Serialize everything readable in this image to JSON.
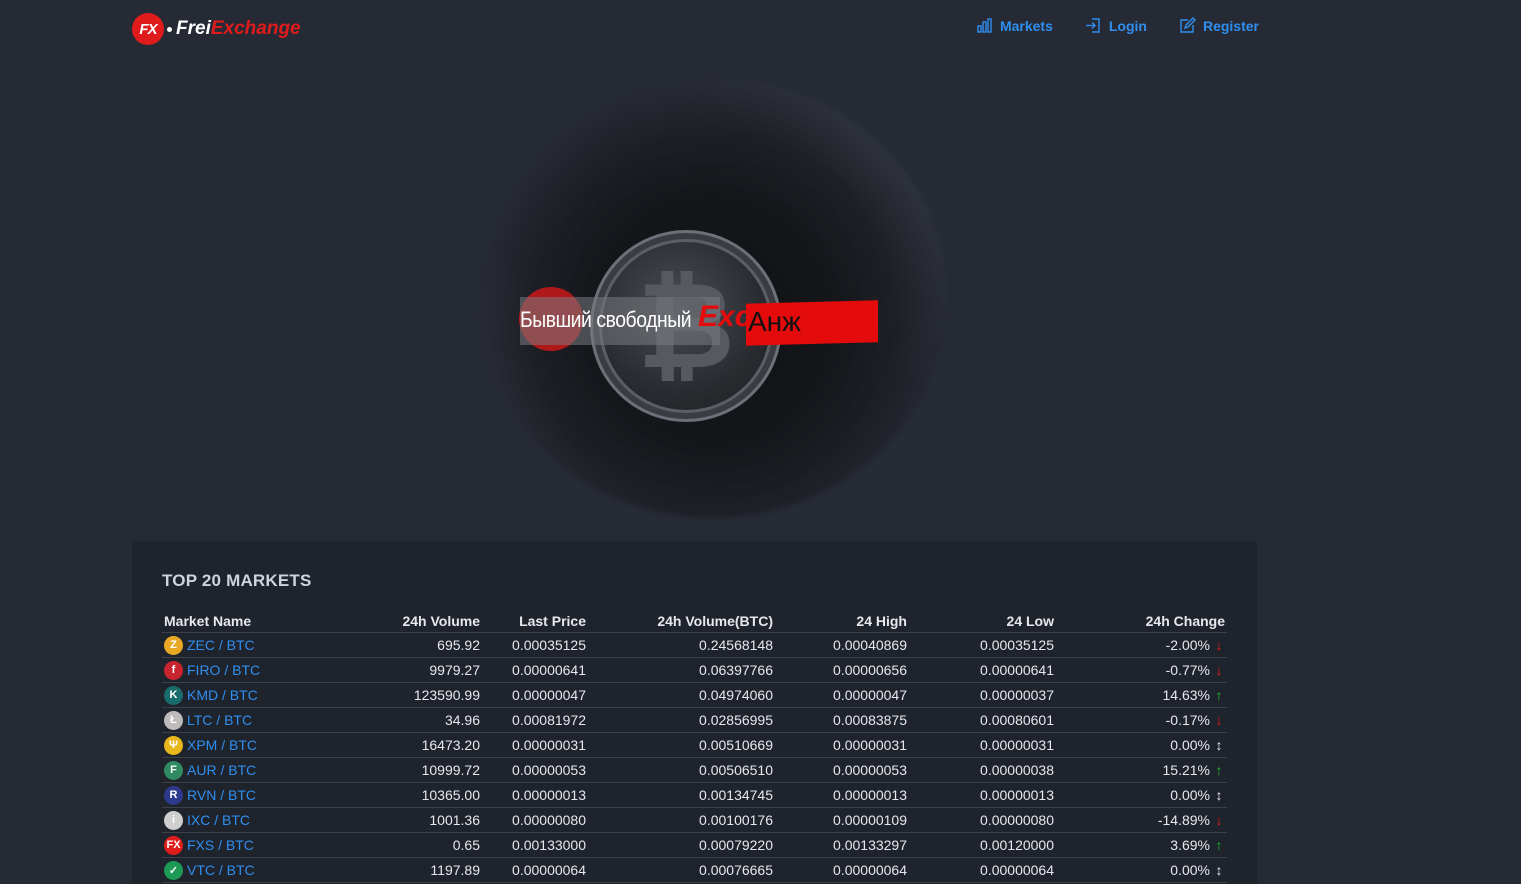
{
  "header": {
    "logo_badge": "FX",
    "logo_part1": "Frei",
    "logo_part2": "Exchange",
    "nav": [
      {
        "label": "Markets",
        "icon": "bar-chart-icon"
      },
      {
        "label": "Login",
        "icon": "login-icon"
      },
      {
        "label": "Register",
        "icon": "edit-icon"
      }
    ]
  },
  "hero": {
    "banner_text": "Бывший свободный",
    "banner_exc": "Exc",
    "banner_anzh": "Анж"
  },
  "markets": {
    "title": "TOP 20 MARKETS",
    "columns": [
      "Market Name",
      "24h Volume",
      "Last Price",
      "24h Volume(BTC)",
      "24 High",
      "24 Low",
      "24h Change"
    ],
    "rows": [
      {
        "market": "ZEC / BTC",
        "icon_color": "#e8a823",
        "icon_glyph": "Z",
        "volume": "695.92",
        "last": "0.00035125",
        "vol_btc": "0.24568148",
        "high": "0.00040869",
        "low": "0.00035125",
        "change": "-2.00%",
        "dir": "down"
      },
      {
        "market": "FIRO / BTC",
        "icon_color": "#c8242f",
        "icon_glyph": "f",
        "volume": "9979.27",
        "last": "0.00000641",
        "vol_btc": "0.06397766",
        "high": "0.00000656",
        "low": "0.00000641",
        "change": "-0.77%",
        "dir": "down"
      },
      {
        "market": "KMD / BTC",
        "icon_color": "#1a6b6b",
        "icon_glyph": "K",
        "volume": "123590.99",
        "last": "0.00000047",
        "vol_btc": "0.04974060",
        "high": "0.00000047",
        "low": "0.00000037",
        "change": "14.63%",
        "dir": "up"
      },
      {
        "market": "LTC / BTC",
        "icon_color": "#bfbbbb",
        "icon_glyph": "Ł",
        "volume": "34.96",
        "last": "0.00081972",
        "vol_btc": "0.02856995",
        "high": "0.00083875",
        "low": "0.00080601",
        "change": "-0.17%",
        "dir": "down"
      },
      {
        "market": "XPM / BTC",
        "icon_color": "#e9b61c",
        "icon_glyph": "Ψ",
        "volume": "16473.20",
        "last": "0.00000031",
        "vol_btc": "0.00510669",
        "high": "0.00000031",
        "low": "0.00000031",
        "change": "0.00%",
        "dir": "flat"
      },
      {
        "market": "AUR / BTC",
        "icon_color": "#2f8a61",
        "icon_glyph": "F",
        "volume": "10999.72",
        "last": "0.00000053",
        "vol_btc": "0.00506510",
        "high": "0.00000053",
        "low": "0.00000038",
        "change": "15.21%",
        "dir": "up"
      },
      {
        "market": "RVN / BTC",
        "icon_color": "#2d3a8c",
        "icon_glyph": "R",
        "volume": "10365.00",
        "last": "0.00000013",
        "vol_btc": "0.00134745",
        "high": "0.00000013",
        "low": "0.00000013",
        "change": "0.00%",
        "dir": "flat"
      },
      {
        "market": "IXC / BTC",
        "icon_color": "#cfcfcf",
        "icon_glyph": "i",
        "volume": "1001.36",
        "last": "0.00000080",
        "vol_btc": "0.00100176",
        "high": "0.00000109",
        "low": "0.00000080",
        "change": "-14.89%",
        "dir": "down"
      },
      {
        "market": "FXS / BTC",
        "icon_color": "#e01b1b",
        "icon_glyph": "FX",
        "volume": "0.65",
        "last": "0.00133000",
        "vol_btc": "0.00079220",
        "high": "0.00133297",
        "low": "0.00120000",
        "change": "3.69%",
        "dir": "up"
      },
      {
        "market": "VTC / BTC",
        "icon_color": "#1d9a55",
        "icon_glyph": "✓",
        "volume": "1197.89",
        "last": "0.00000064",
        "vol_btc": "0.00076665",
        "high": "0.00000064",
        "low": "0.00000064",
        "change": "0.00%",
        "dir": "flat"
      }
    ]
  }
}
